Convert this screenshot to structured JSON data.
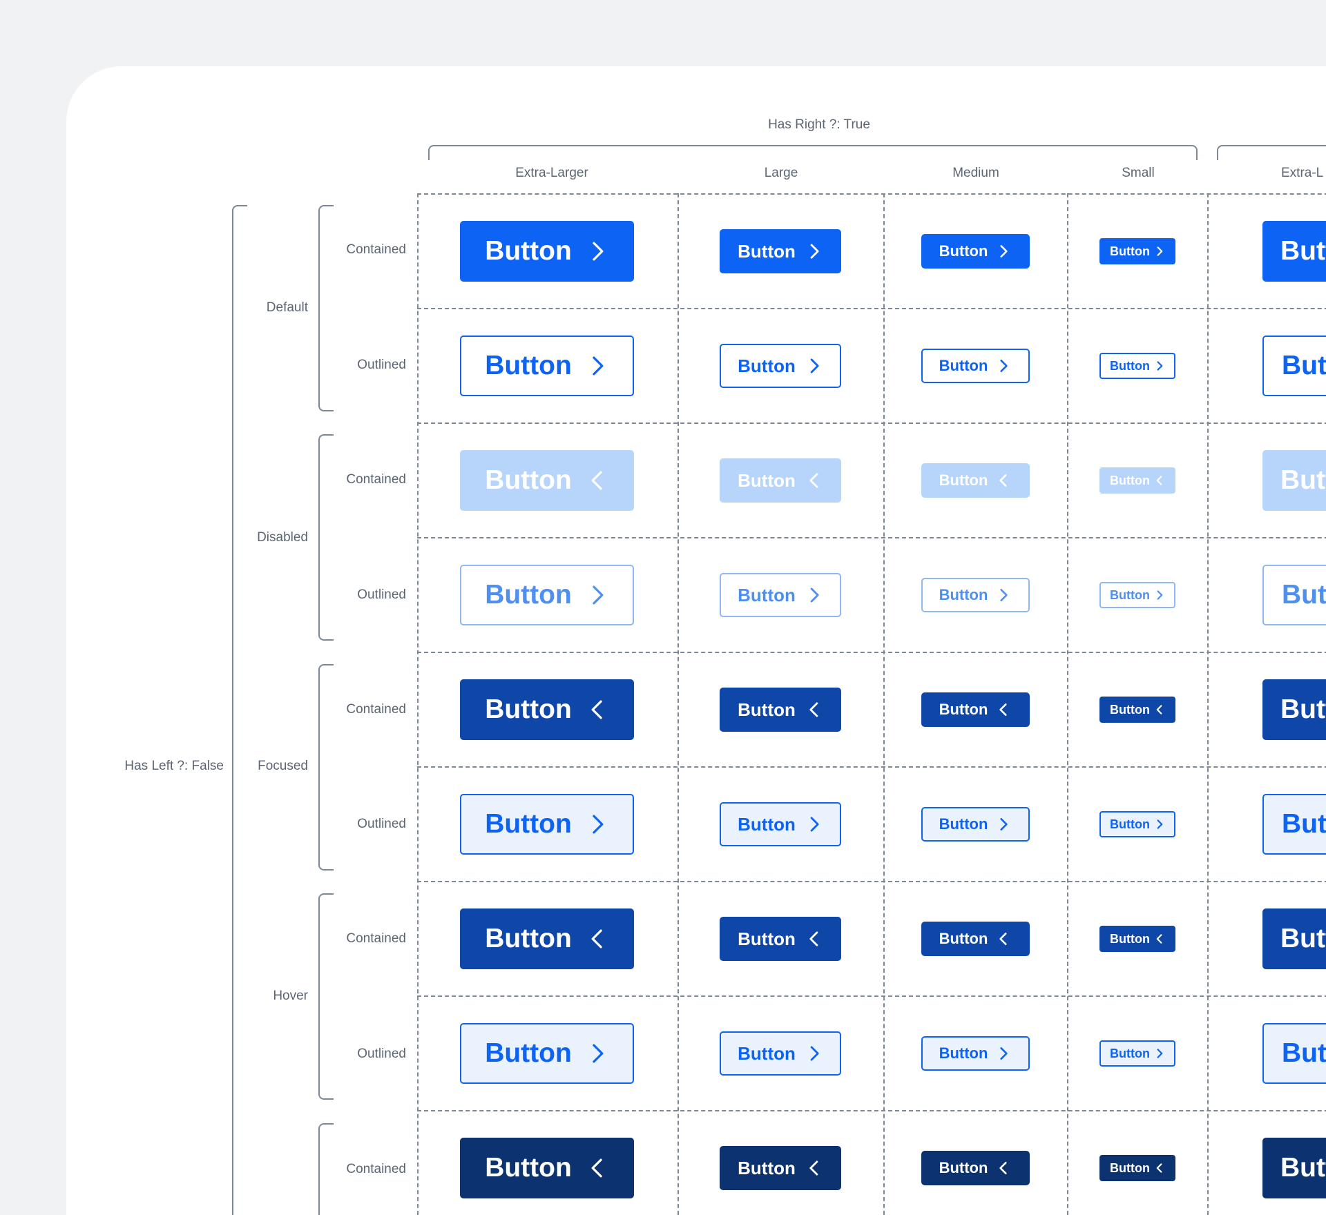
{
  "has_right_label": "Has Right ?: True",
  "has_left_label": "Has Left ?: False",
  "columns": [
    "Extra-Larger",
    "Large",
    "Medium",
    "Small",
    "Extra-L"
  ],
  "states": [
    "Default",
    "Disabled",
    "Focused",
    "Hover"
  ],
  "variants": [
    "Contained",
    "Outlined"
  ],
  "button_label": "Button",
  "button_label_partial": "Butt",
  "colors": {
    "default_contained": "#0d63f3",
    "disabled_contained": "#b7d4fb",
    "disabled_outline": "#8fb7f5",
    "focused_contained": "#0f47a9",
    "hover_contained": "#0f47a9",
    "pressed_contained": "#0c336f",
    "outline_fill": "#eaf2fd",
    "label_gray": "#5b6573",
    "dash": "#7c8897"
  },
  "icons": [
    "chevron-right-icon",
    "chevron-left-icon"
  ]
}
